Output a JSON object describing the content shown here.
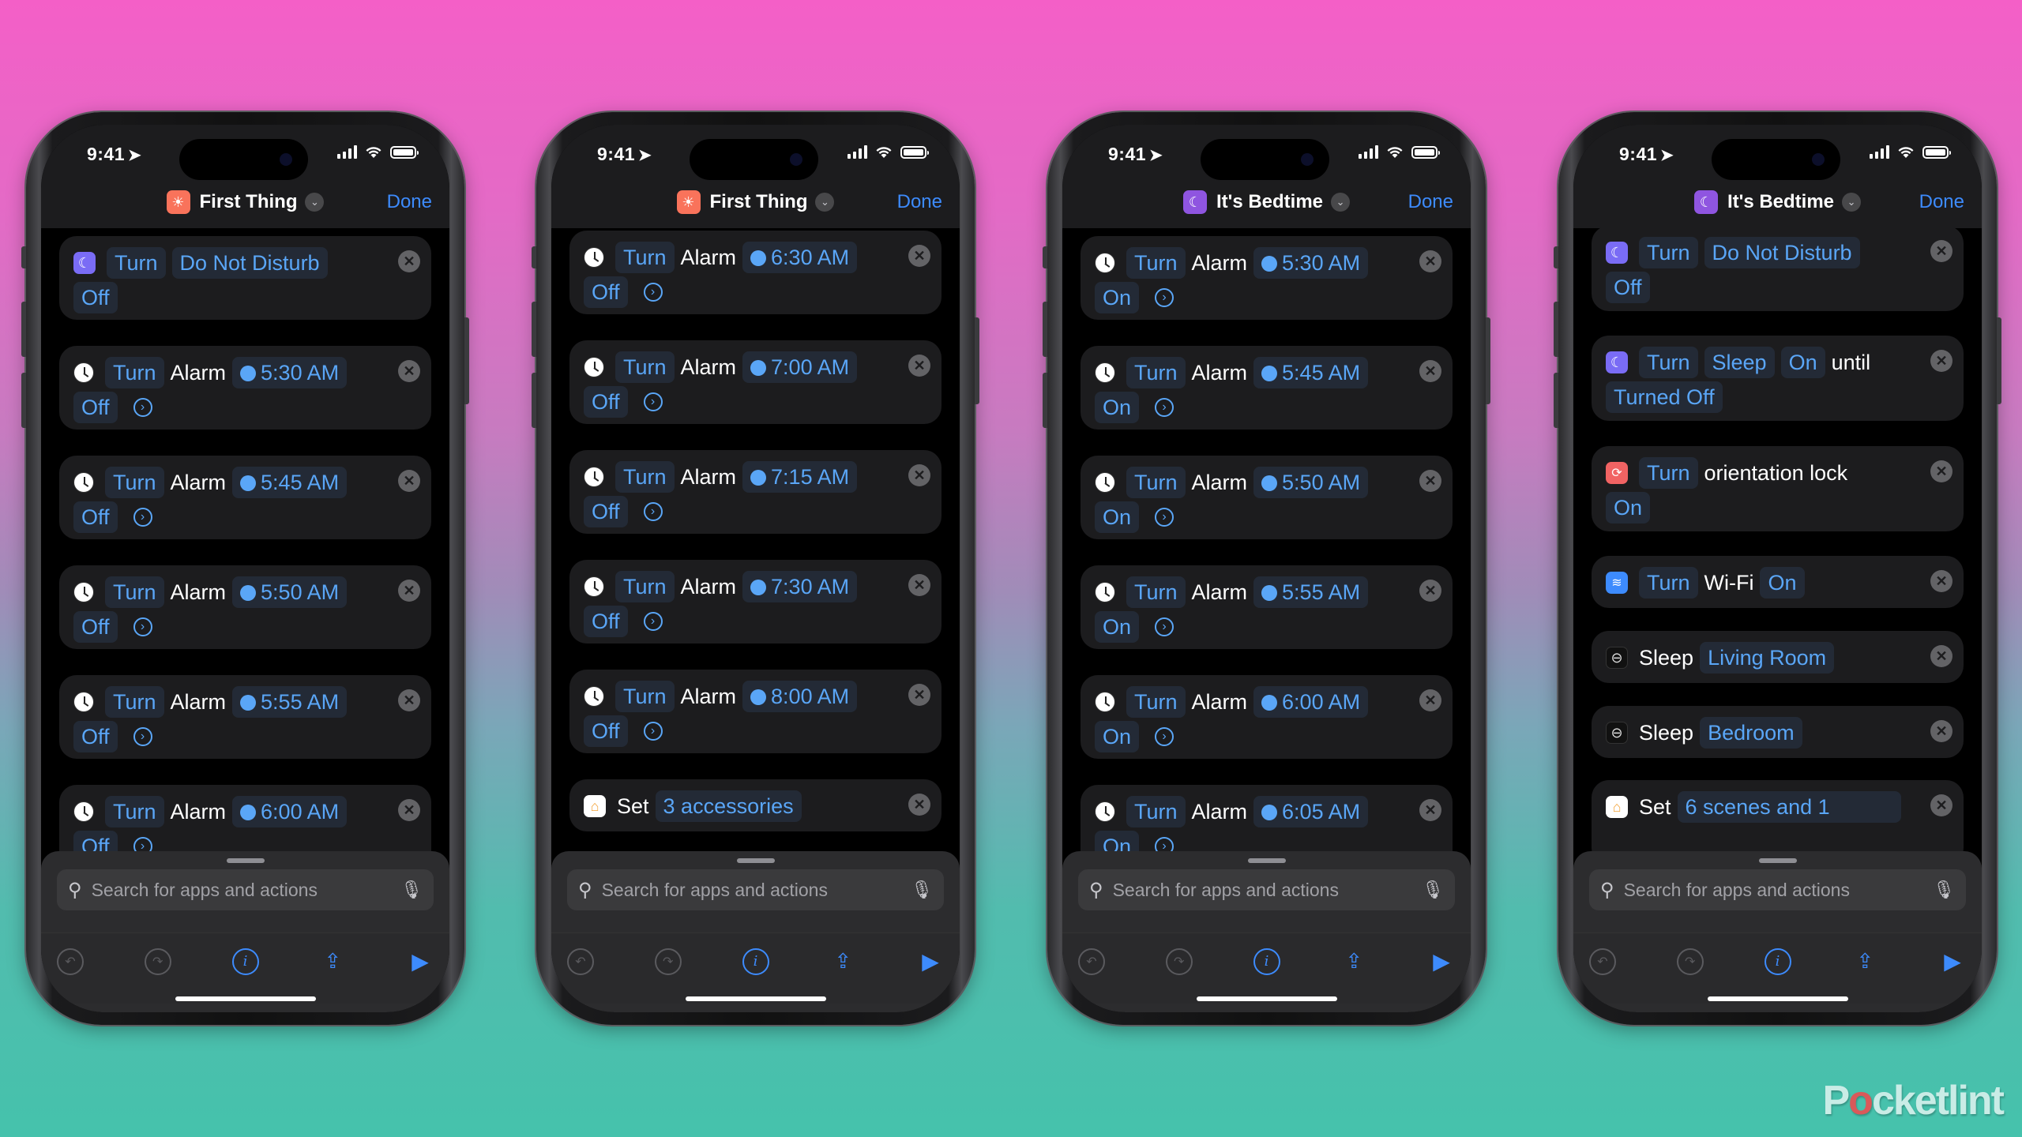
{
  "status": {
    "time": "9:41"
  },
  "colors": {
    "accent": "#3d8bfd",
    "token_text": "#5aa6f7",
    "card_bg": "#1c1c1e",
    "first_thing_icon": "#f9735b",
    "bedtime_icon": "#8f55e0"
  },
  "search_placeholder": "Search for apps and actions",
  "done_label": "Done",
  "watermark": {
    "pre": "P",
    "o": "o",
    "post": "cketlint"
  },
  "phones": [
    {
      "title": "First Thing",
      "icon": "sunrise-icon",
      "actions": [
        {
          "icon": "focus-moon-icon",
          "verb": "Turn",
          "object": "Do Not Disturb",
          "object_is_token": true,
          "value": "Off",
          "has_more": false
        },
        {
          "icon": "clock-icon",
          "verb": "Turn",
          "object": "Alarm",
          "object_is_token": false,
          "time": "5:30 AM",
          "value": "Off",
          "has_more": true
        },
        {
          "icon": "clock-icon",
          "verb": "Turn",
          "object": "Alarm",
          "object_is_token": false,
          "time": "5:45 AM",
          "value": "Off",
          "has_more": true
        },
        {
          "icon": "clock-icon",
          "verb": "Turn",
          "object": "Alarm",
          "object_is_token": false,
          "time": "5:50 AM",
          "value": "Off",
          "has_more": true
        },
        {
          "icon": "clock-icon",
          "verb": "Turn",
          "object": "Alarm",
          "object_is_token": false,
          "time": "5:55 AM",
          "value": "Off",
          "has_more": true
        },
        {
          "icon": "clock-icon",
          "verb": "Turn",
          "object": "Alarm",
          "object_is_token": false,
          "time": "6:00 AM",
          "value": "Off",
          "has_more": true
        }
      ]
    },
    {
      "title": "First Thing",
      "icon": "sunrise-icon",
      "actions": [
        {
          "icon": "clock-icon",
          "verb": "Turn",
          "object": "Alarm",
          "time": "6:30 AM",
          "value": "Off",
          "has_more": true
        },
        {
          "icon": "clock-icon",
          "verb": "Turn",
          "object": "Alarm",
          "time": "7:00 AM",
          "value": "Off",
          "has_more": true
        },
        {
          "icon": "clock-icon",
          "verb": "Turn",
          "object": "Alarm",
          "time": "7:15 AM",
          "value": "Off",
          "has_more": true
        },
        {
          "icon": "clock-icon",
          "verb": "Turn",
          "object": "Alarm",
          "time": "7:30 AM",
          "value": "Off",
          "has_more": true
        },
        {
          "icon": "clock-icon",
          "verb": "Turn",
          "object": "Alarm",
          "time": "8:00 AM",
          "value": "Off",
          "has_more": true
        },
        {
          "icon": "home-icon",
          "verb": "Set",
          "param": "3 accessories"
        }
      ]
    },
    {
      "title": "It's Bedtime",
      "icon": "moon-icon",
      "actions": [
        {
          "icon": "clock-icon",
          "verb": "Turn",
          "object": "Alarm",
          "time": "5:30 AM",
          "value": "On",
          "has_more": true
        },
        {
          "icon": "clock-icon",
          "verb": "Turn",
          "object": "Alarm",
          "time": "5:45 AM",
          "value": "On",
          "has_more": true
        },
        {
          "icon": "clock-icon",
          "verb": "Turn",
          "object": "Alarm",
          "time": "5:50 AM",
          "value": "On",
          "has_more": true
        },
        {
          "icon": "clock-icon",
          "verb": "Turn",
          "object": "Alarm",
          "time": "5:55 AM",
          "value": "On",
          "has_more": true
        },
        {
          "icon": "clock-icon",
          "verb": "Turn",
          "object": "Alarm",
          "time": "6:00 AM",
          "value": "On",
          "has_more": true
        },
        {
          "icon": "clock-icon",
          "verb": "Turn",
          "object": "Alarm",
          "time": "6:05 AM",
          "value": "On",
          "has_more": true
        }
      ]
    },
    {
      "title": "It's Bedtime",
      "icon": "moon-icon",
      "actions": [
        {
          "icon": "focus-moon-icon",
          "verb": "Turn",
          "object": "Do Not Disturb",
          "value": "Off"
        },
        {
          "icon": "focus-moon-icon",
          "verb": "Turn",
          "object": "Sleep",
          "value": "On",
          "suffix": "until",
          "value2": "Turned Off"
        },
        {
          "icon": "orientation-lock-icon",
          "verb": "Turn",
          "object": "orientation lock",
          "value": "On"
        },
        {
          "icon": "wifi-icon",
          "verb": "Turn",
          "object": "Wi-Fi",
          "value": "On"
        },
        {
          "icon": "sleep-display-icon",
          "verb": "Sleep",
          "param": "Living Room"
        },
        {
          "icon": "sleep-display-icon",
          "verb": "Sleep",
          "param": "Bedroom"
        },
        {
          "icon": "home-icon",
          "verb": "Set",
          "param": "6 scenes and 1"
        }
      ]
    }
  ]
}
